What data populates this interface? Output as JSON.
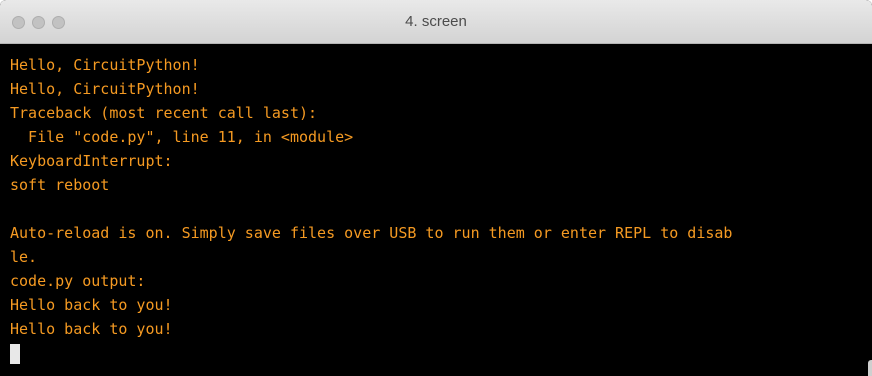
{
  "window": {
    "title": "4. screen"
  },
  "terminal": {
    "lines": [
      "Hello, CircuitPython!",
      "Hello, CircuitPython!",
      "Traceback (most recent call last):",
      "  File \"code.py\", line 11, in <module>",
      "KeyboardInterrupt:",
      "soft reboot",
      "",
      "Auto-reload is on. Simply save files over USB to run them or enter REPL to disab",
      "le.",
      "code.py output:",
      "Hello back to you!",
      "Hello back to you!"
    ],
    "text_color": "#f59a22",
    "background_color": "#000000",
    "cursor_color": "#e8e8e8"
  }
}
